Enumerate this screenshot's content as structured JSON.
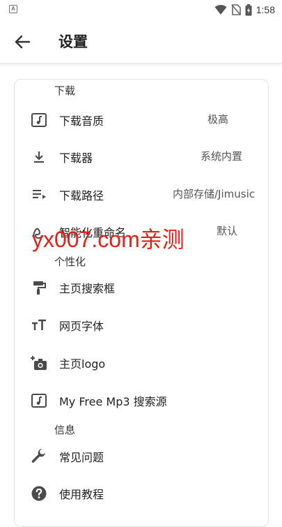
{
  "status_bar": {
    "time": "1:58",
    "notification_badge": "A"
  },
  "header": {
    "title": "设置"
  },
  "sections": {
    "download": {
      "title": "下载"
    },
    "personalize": {
      "title": "个性化"
    },
    "info": {
      "title": "信息"
    }
  },
  "items": {
    "quality": {
      "label": "下载音质",
      "value": "极高"
    },
    "downloader": {
      "label": "下载器",
      "value": "系统内置"
    },
    "path": {
      "label": "下载路径",
      "value": "内部存储/Jimusic"
    },
    "naming": {
      "label": "智能化重命名",
      "value": "默认"
    },
    "homepage_search": {
      "label": "主页搜索框"
    },
    "web_font": {
      "label": "网页字体"
    },
    "homepage_logo": {
      "label": "主页logo"
    },
    "search_source": {
      "label": "My Free Mp3 搜索源"
    },
    "faq": {
      "label": "常见问题"
    },
    "tutorial": {
      "label": "使用教程"
    }
  },
  "watermark": "yx007.com亲测",
  "colors": {
    "watermark": "#e0201a",
    "icon": "#4a4a4a"
  }
}
